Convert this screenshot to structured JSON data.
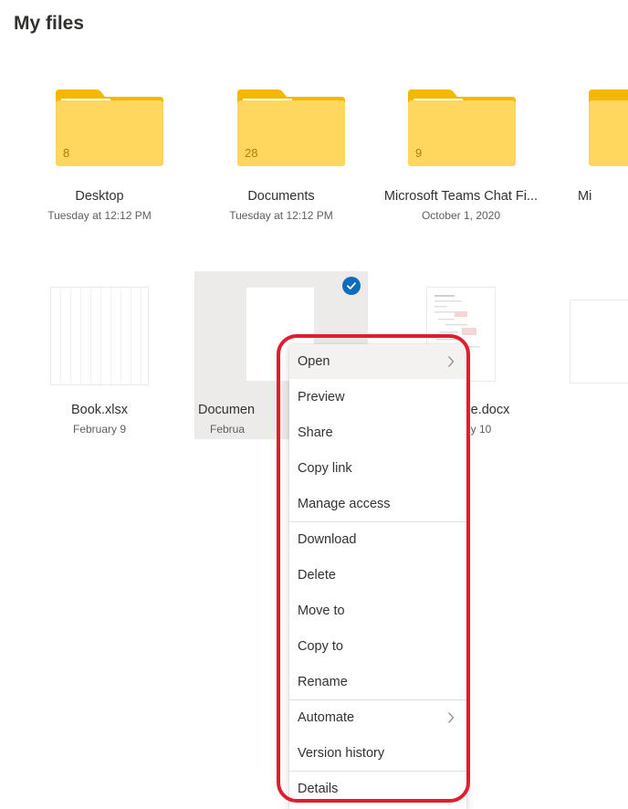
{
  "header": {
    "title": "My files"
  },
  "folders": [
    {
      "name": "Desktop",
      "date": "Tuesday at 12:12 PM",
      "count": "8"
    },
    {
      "name": "Documents",
      "date": "Tuesday at 12:12 PM",
      "count": "28"
    },
    {
      "name": "Microsoft Teams Chat Fi...",
      "date": "October 1, 2020",
      "count": "9"
    },
    {
      "name": "Mi",
      "date": "",
      "count": ""
    }
  ],
  "files": [
    {
      "name": "Book.xlsx",
      "date": "February 9"
    },
    {
      "name": "Documen",
      "date": "Februa"
    },
    {
      "name": "e.docx",
      "date": "y 10"
    },
    {
      "name": "",
      "date": ""
    }
  ],
  "context_menu": {
    "items": [
      {
        "label": "Open",
        "has_submenu": true
      },
      {
        "label": "Preview"
      },
      {
        "label": "Share"
      },
      {
        "label": "Copy link"
      },
      {
        "label": "Manage access"
      },
      {
        "label": "Download"
      },
      {
        "label": "Delete"
      },
      {
        "label": "Move to"
      },
      {
        "label": "Copy to"
      },
      {
        "label": "Rename"
      },
      {
        "label": "Automate",
        "has_submenu": true
      },
      {
        "label": "Version history"
      },
      {
        "label": "Details"
      }
    ]
  },
  "icons": {
    "folder": "folder-icon",
    "check": "checkmark-icon",
    "chevron": "chevron-right-icon"
  },
  "colors": {
    "folder_fill": "#ffd75e",
    "folder_tab": "#f5b800",
    "selected_check": "#0f6cbd",
    "highlight_annotation": "#e01e2f",
    "selection_background": "#edebe9"
  }
}
